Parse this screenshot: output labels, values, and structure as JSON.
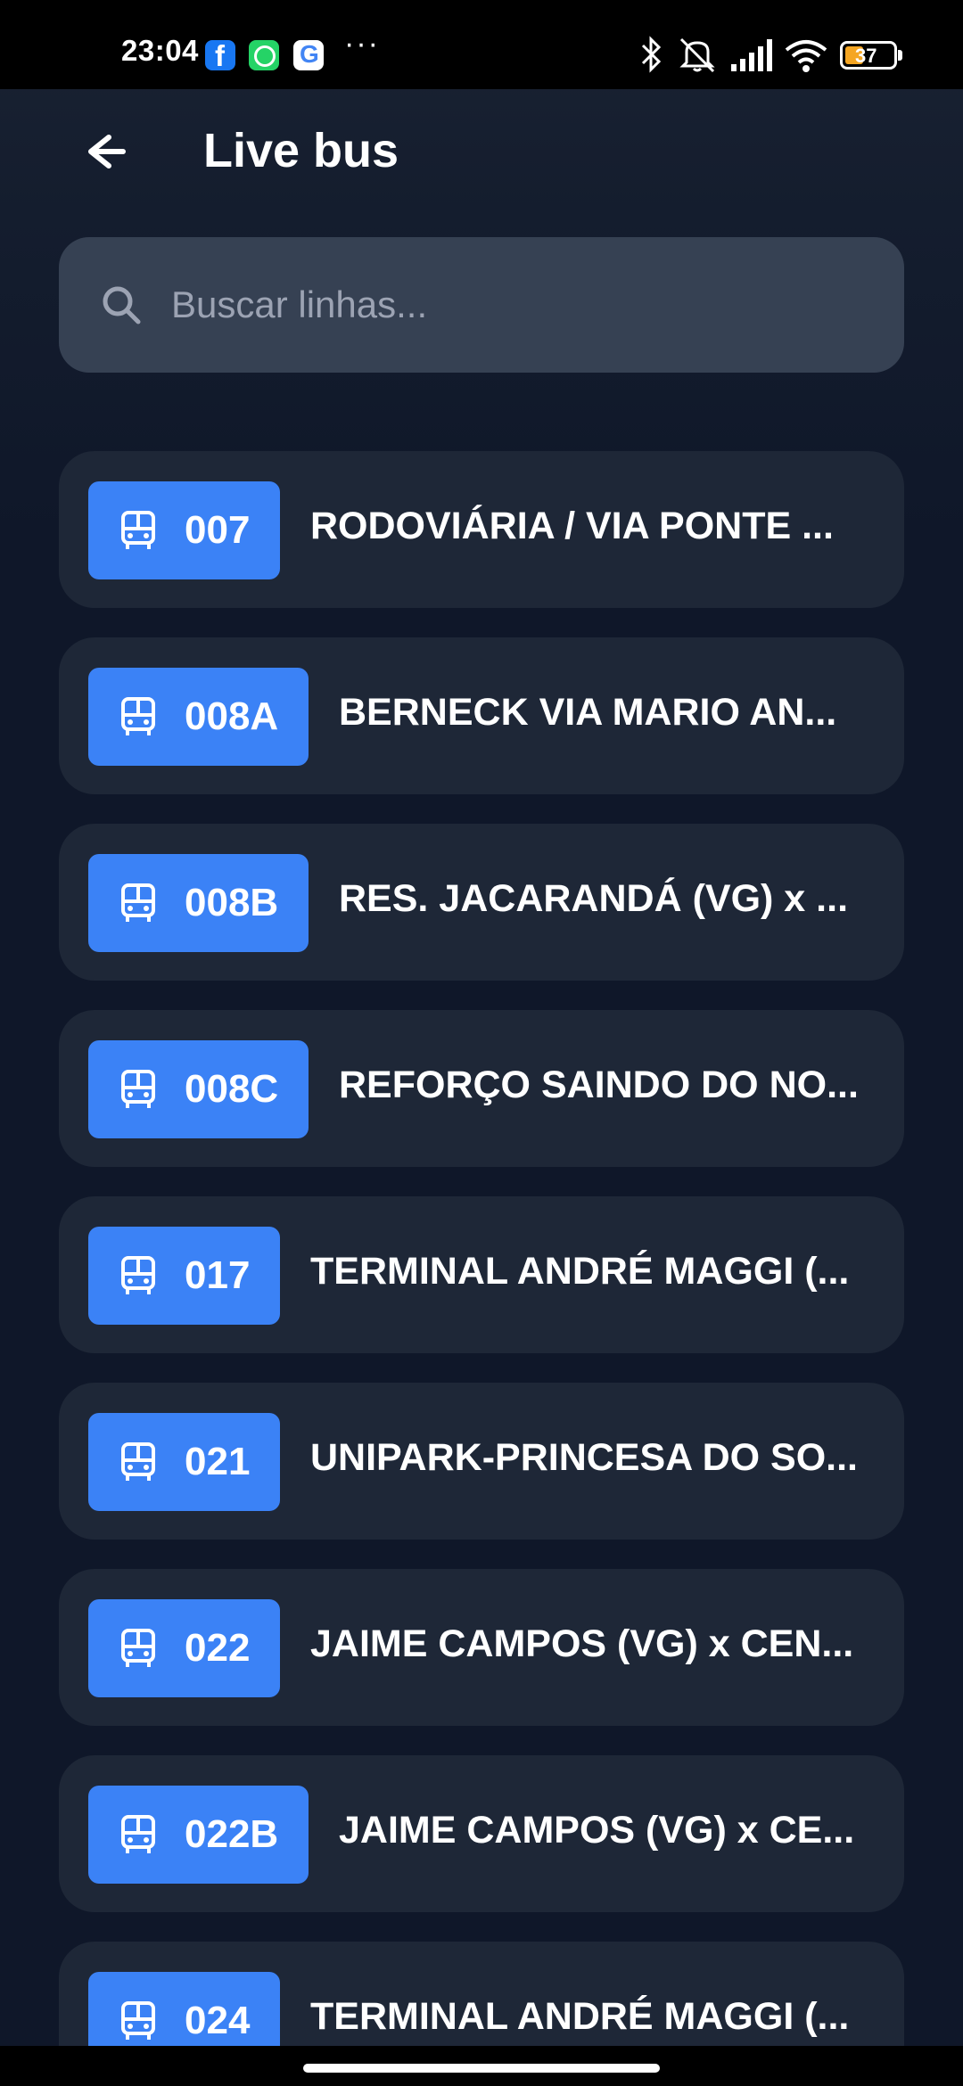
{
  "status_bar": {
    "time": "23:04",
    "notifications": [
      "facebook-icon",
      "whatsapp-icon",
      "google-icon"
    ],
    "more": "···",
    "battery": "37"
  },
  "header": {
    "title": "Live bus",
    "back_icon": "arrow-left-icon"
  },
  "search": {
    "placeholder": "Buscar linhas...",
    "value": ""
  },
  "routes": [
    {
      "code": "007",
      "name": "RODOVIÁRIA / VIA PONTE ..."
    },
    {
      "code": "008A",
      "name": "BERNECK VIA MARIO AN..."
    },
    {
      "code": "008B",
      "name": "RES. JACARANDÁ (VG) x ..."
    },
    {
      "code": "008C",
      "name": "REFORÇO SAINDO DO NO..."
    },
    {
      "code": "017",
      "name": "TERMINAL ANDRÉ MAGGI (..."
    },
    {
      "code": "021",
      "name": "UNIPARK-PRINCESA DO SO..."
    },
    {
      "code": "022",
      "name": "JAIME CAMPOS (VG) x CEN..."
    },
    {
      "code": "022B",
      "name": "JAIME CAMPOS (VG) x CE..."
    },
    {
      "code": "024",
      "name": "TERMINAL ANDRÉ MAGGI (..."
    }
  ],
  "colors": {
    "background": "#0f1729",
    "card": "#1e2737",
    "search": "#364153",
    "badge": "#3b82f6"
  }
}
